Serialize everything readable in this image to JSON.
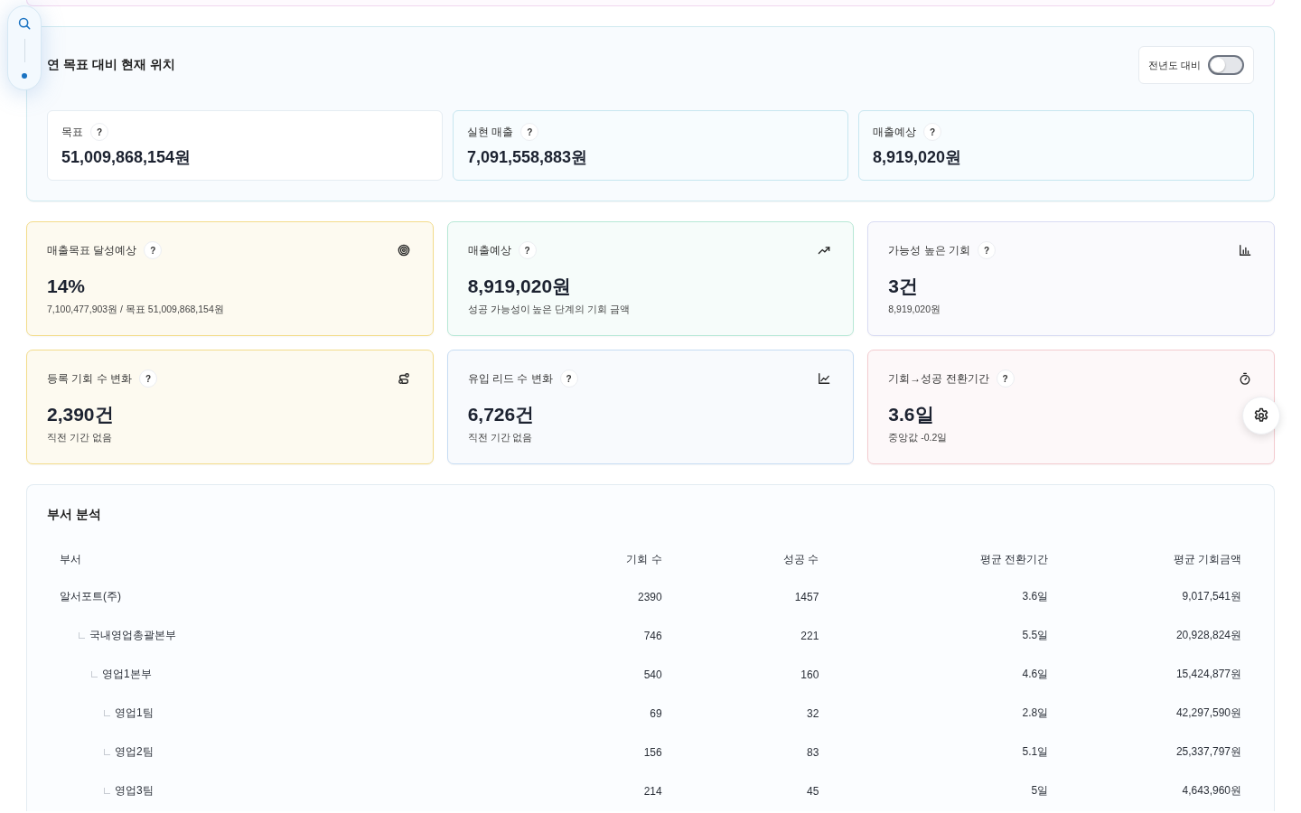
{
  "rail": {
    "active_dot": true
  },
  "position": {
    "title": "연 목표 대비 현재 위치",
    "toggle": {
      "label": "전년도 대비",
      "on": false
    },
    "stats": [
      {
        "label": "목표",
        "help": "?",
        "value": "51,009,868,154원"
      },
      {
        "label": "실현 매출",
        "help": "?",
        "value": "7,091,558,883원"
      },
      {
        "label": "매출예상",
        "help": "?",
        "value": "8,919,020원"
      }
    ]
  },
  "metrics": [
    {
      "label": "매출목표 달성예상",
      "help": "?",
      "value": "14%",
      "note": "7,100,477,903원 / 목표 51,009,868,154원",
      "color": "#f3dc8a"
    },
    {
      "label": "매출예상",
      "help": "?",
      "value": "8,919,020원",
      "note": "성공 가능성이 높은 단계의 기회 금액",
      "color": "#b7e8d6"
    },
    {
      "label": "가능성 높은 기회",
      "help": "?",
      "value": "3건",
      "note": "8,919,020원",
      "color": "#d8dbf3"
    },
    {
      "label": "등록 기회 수 변화",
      "help": "?",
      "value": "2,390건",
      "note": "직전 기간 없음",
      "color": "#f3dc8a"
    },
    {
      "label": "유입 리드 수 변화",
      "help": "?",
      "value": "6,726건",
      "note": "직전 기간 없음",
      "color": "#c6dcf3"
    },
    {
      "label": "기회→성공 전환기간",
      "help": "?",
      "value": "3.6일",
      "note": "중앙값 -0.2일",
      "color": "#f3cbcf"
    }
  ],
  "department_analysis": {
    "title": "부서 분석",
    "columns": [
      "부서",
      "기회 수",
      "성공 수",
      "평균 전환기간",
      "평균 기회금액"
    ],
    "rows": [
      {
        "cells": [
          "알서포트(주)",
          "2390",
          "1457",
          "3.6일",
          "9,017,541원"
        ],
        "children": [
          {
            "cells": [
              "국내영업총괄본부",
              "746",
              "221",
              "5.5일",
              "20,928,824원"
            ],
            "children": [
              {
                "cells": [
                  "영업1본부",
                  "540",
                  "160",
                  "4.6일",
                  "15,424,877원"
                ],
                "children": [
                  {
                    "cells": [
                      "영업1팀",
                      "69",
                      "32",
                      "2.8일",
                      "42,297,590원"
                    ]
                  },
                  {
                    "cells": [
                      "영업2팀",
                      "156",
                      "83",
                      "5.1일",
                      "25,337,797원"
                    ]
                  },
                  {
                    "cells": [
                      "영업3팀",
                      "214",
                      "45",
                      "5일",
                      "4,643,960원"
                    ]
                  }
                ]
              }
            ]
          }
        ]
      }
    ]
  }
}
